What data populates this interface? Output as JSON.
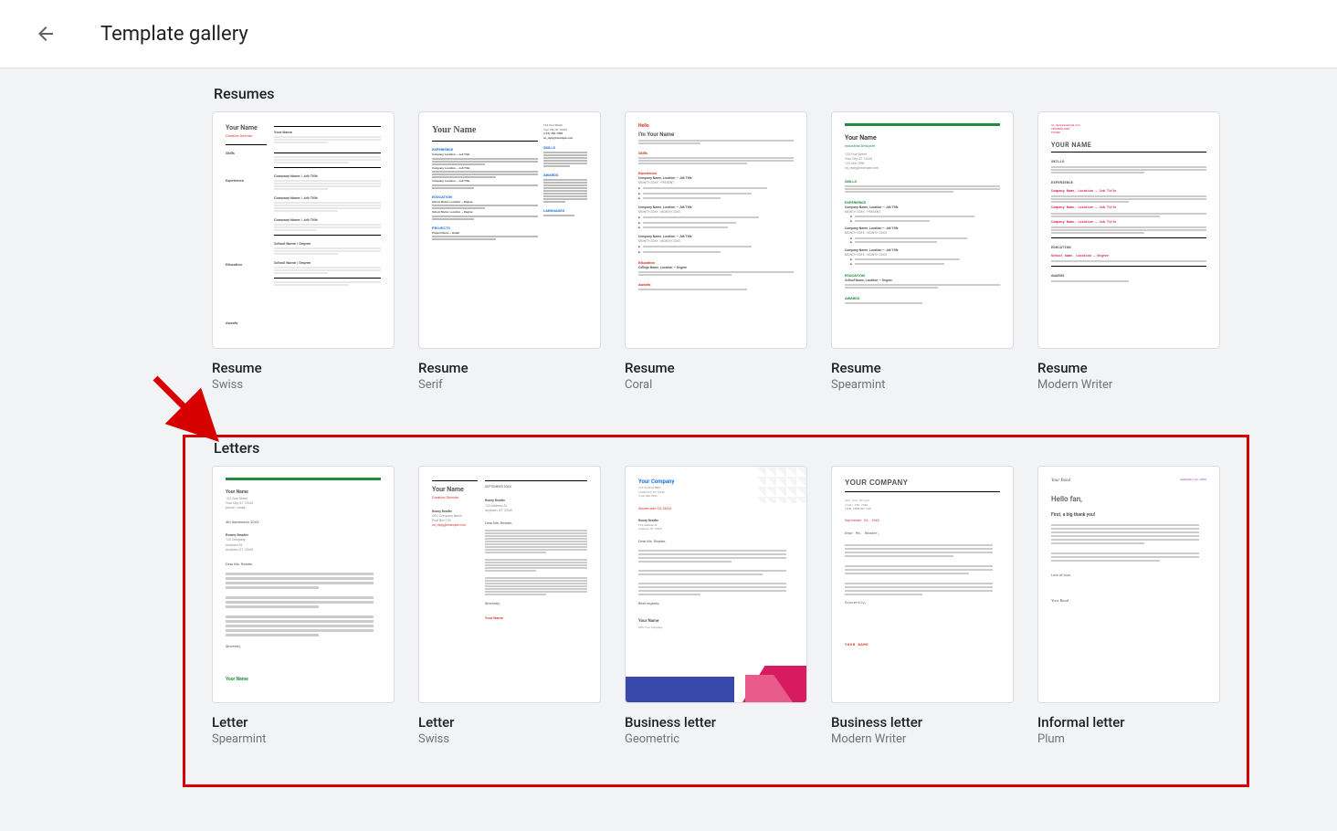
{
  "header": {
    "title": "Template gallery"
  },
  "sections": {
    "resumes": {
      "title": "Resumes",
      "items": [
        {
          "title": "Resume",
          "subtitle": "Swiss"
        },
        {
          "title": "Resume",
          "subtitle": "Serif"
        },
        {
          "title": "Resume",
          "subtitle": "Coral"
        },
        {
          "title": "Resume",
          "subtitle": "Spearmint"
        },
        {
          "title": "Resume",
          "subtitle": "Modern Writer"
        }
      ]
    },
    "letters": {
      "title": "Letters",
      "items": [
        {
          "title": "Letter",
          "subtitle": "Spearmint"
        },
        {
          "title": "Letter",
          "subtitle": "Swiss"
        },
        {
          "title": "Business letter",
          "subtitle": "Geometric"
        },
        {
          "title": "Business letter",
          "subtitle": "Modern Writer"
        },
        {
          "title": "Informal letter",
          "subtitle": "Plum"
        }
      ]
    }
  },
  "thumb": {
    "swiss": {
      "name": "Your Name",
      "role": "Creative Director",
      "contact": "Your Name",
      "s1": "Skills",
      "s2": "Experience",
      "s3": "Education",
      "s4": "Awards",
      "h1": "Company Name / Job Title",
      "h2": "Company Name / Job Title",
      "h3": "Company Name / Job Title",
      "h4": "School Name / Degree",
      "h5": "School Name / Degree"
    },
    "serif": {
      "name": "Your Name",
      "h1": "EXPERIENCE",
      "c1": "Company, Location — Job Title",
      "c2": "Company, Location — Job Title",
      "c3": "Company, Location — Job Title",
      "h2": "EDUCATION",
      "e1": "School Name, Location — Degree",
      "e2": "School Name, Location — Degree",
      "h3": "PROJECTS",
      "p1": "Project Name — Detail",
      "sh1": "SKILLS",
      "sh2": "AWARDS",
      "sh3": "LANGUAGES",
      "addr": "123 Your Street",
      "city": "Your City, ST 12345",
      "phone": "(123) 456-7890",
      "email": "no_reply@example.com"
    },
    "coral": {
      "hello": "Hello",
      "name": "I'm Your Name",
      "h1": "Skills",
      "h2": "Experience",
      "c1": "Company Name, Location — Job Title",
      "c2": "Company Name, Location — Job Title",
      "c3": "Company Name, Location — Job Title",
      "h3": "Education",
      "e1": "College Name, Location — Degree",
      "h4": "Awards"
    },
    "spear": {
      "name": "Your Name",
      "role": "Industrial Designer",
      "addr": "123 Your Street",
      "city": "Your City, ST 12345",
      "phone": "123.456.7890",
      "email": "no_reply@example.com",
      "h1": "SKILLS",
      "h2": "EXPERIENCE",
      "c1": "Company Name, Location — Job Title",
      "c2": "Company Name, Location — Job Title",
      "c3": "Company Name, Location — Job Title",
      "h3": "EDUCATION",
      "e1": "School Name, Location — Degree",
      "h4": "AWARDS"
    },
    "modern": {
      "meta1": "no_reply@example.com",
      "name": "YOUR NAME",
      "h1": "SKILLS",
      "h2": "EXPERIENCE",
      "c1": "Company Name, Location — Job Title",
      "c2": "Company Name, Location — Job Title",
      "c3": "Company Name, Location — Job Title",
      "h3": "EDUCATION",
      "e1": "School name, Location — Degree",
      "h4": "AWARDS"
    },
    "lspear": {
      "name": "Your Name",
      "date": "4th September 20XX",
      "to1": "Ronny Reader",
      "to2": "123 Company",
      "to3": "Anytown 55",
      "to4": "Anytown, ST 12345",
      "greet": "Dear Ms. Reader,",
      "close": "Sincerely,",
      "sig": "Your Name"
    },
    "lswiss": {
      "name": "Your Name",
      "role": "Creative Director",
      "date": "SEPTEMBER 20XX",
      "to1": "Ronny Reader",
      "to2": "CEO, Company Name",
      "to3": "Post Box 123",
      "to4": "no_reply@example.com",
      "greet": "Dear Ms. Reader,",
      "close": "Sincerely,",
      "sig": "Your Name"
    },
    "geo": {
      "company": "Your Company",
      "date": "September 04, 20XX",
      "to1": "Ronny Reader",
      "to2": "Anytown, ST 12345",
      "greet": "Dear Ms. Reader,",
      "close": "Best regards,",
      "sig": "Your Name",
      "sigrole": "CEO, Your Company"
    },
    "lmod": {
      "company": "YOUR COMPANY",
      "date": "September 04, 20XX",
      "greet": "Dear Ms. Reader,",
      "close": "Sincerely,",
      "sig": "YOUR NAME",
      "addr": "123 Your Street"
    },
    "plum": {
      "name": "Your Band",
      "date": "September 04, 20XX",
      "hello": "Hello fan,",
      "sub": "First, a big thank you!",
      "close": "Lots of love,",
      "sig": "Your Band"
    }
  }
}
